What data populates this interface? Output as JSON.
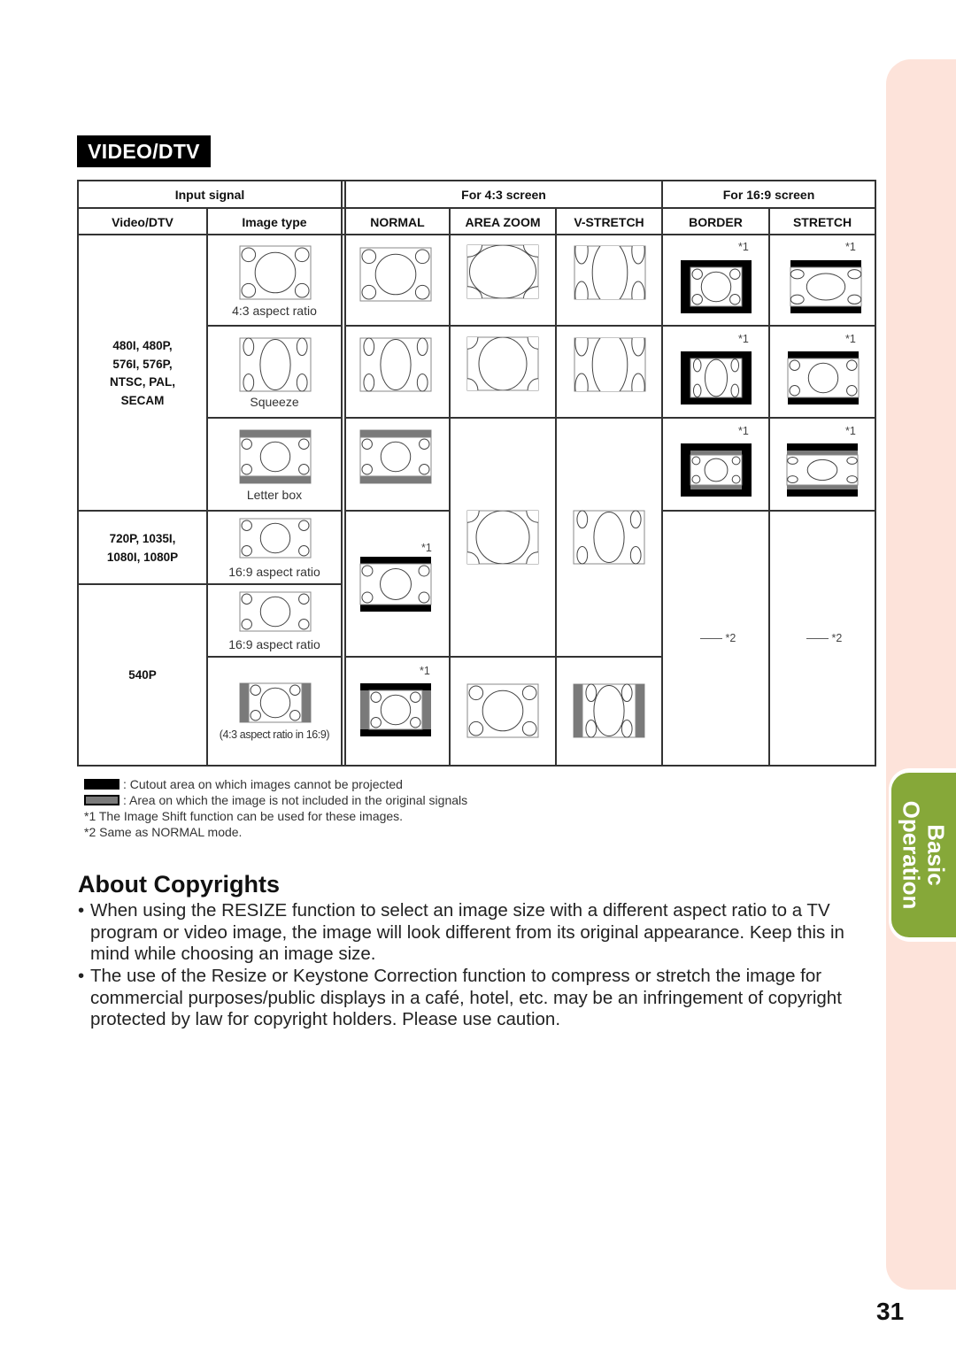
{
  "side_tab": {
    "line1": "Basic",
    "line2": "Operation",
    "color": "#86a839",
    "band_color": "#fde3da"
  },
  "section_badge": "VIDEO/DTV",
  "table": {
    "group_headers": {
      "input_signal": "Input signal",
      "for_43": "For 4:3 screen",
      "for_169": "For 16:9 screen"
    },
    "column_headers": [
      "Video/DTV",
      "Image type",
      "NORMAL",
      "AREA ZOOM",
      "V-STRETCH",
      "BORDER",
      "STRETCH"
    ],
    "signal_groups": [
      {
        "label": "480I, 480P,\n576I, 576P,\nNTSC, PAL,\nSECAM"
      },
      {
        "label": "720P, 1035I,\n1080I, 1080P"
      },
      {
        "label": "540P"
      }
    ],
    "image_types": [
      "4:3 aspect ratio",
      "Squeeze",
      "Letter box",
      "16:9 aspect ratio",
      "16:9 aspect ratio",
      "(4:3 aspect ratio in 16:9)"
    ],
    "note1": "*1",
    "note2_dash": "—— *2"
  },
  "legend": {
    "black": "Cutout area on which images cannot be projected",
    "gray": "Area on which the image is not included in the original signals",
    "black_color": "#000000",
    "gray_color": "#7a7a7a",
    "footnote1": "*1 The Image Shift function can be used for these images.",
    "footnote2": "*2 Same as NORMAL mode."
  },
  "copyrights": {
    "title": "About Copyrights",
    "bullets": [
      "When using the RESIZE function to select an image size with a different aspect ratio to a TV program or video image, the image will look different from its original appearance. Keep this in mind while choosing an image size.",
      "The use of the Resize or Keystone Correction function to compress or stretch the image for commercial purposes/public displays in a café, hotel, etc. may be an infringement of copyright protected by law for copyright holders. Please use caution."
    ]
  },
  "page_number": "31"
}
